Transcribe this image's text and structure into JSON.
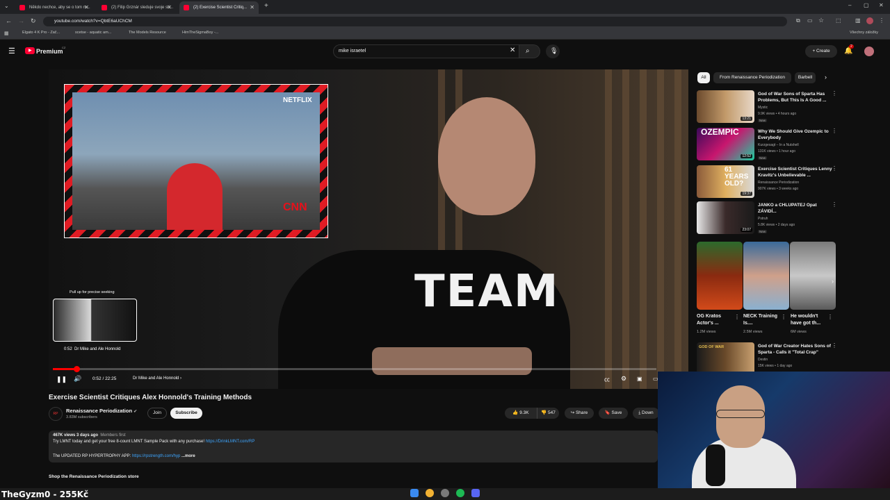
{
  "browser": {
    "tabs": [
      {
        "label": "Někdo nechce, aby se o tom m..."
      },
      {
        "label": "(2) Filip Grznár sleduje svoje sti..."
      },
      {
        "label": "(2) Exercise Scientist Critiq..."
      }
    ],
    "url": "youtube.com/watch?v=QbtE6aUChCM",
    "bookmarks": [
      "Elgato 4 K Pro - Zač...",
      "scetse - aquatic am...",
      "The Models Resource",
      "HimTheSigmaBoy -..."
    ],
    "all_bookmarks": "Všechny záložky"
  },
  "yt": {
    "logo": "Premium",
    "logo_region": "CZ",
    "search_value": "mike israetel",
    "create_label": "Create",
    "notif_count": "2"
  },
  "player": {
    "pip_netflix": "NETFLIX",
    "pip_cnn": "CNN",
    "shirt_text": "TEAM",
    "preview_hint": "Pull up for precise seeking",
    "preview_time": "0:52",
    "preview_chapter": "Dr Mike and Ale Honnold",
    "time": "0:52 / 22:25",
    "chapter": "Dr Mike and Ale Honnold",
    "progress_fraction": 0.039
  },
  "video": {
    "title": "Exercise Scientist Critiques Alex Honnold's Training Methods",
    "channel": "Renaissance Periodization",
    "channel_avatar_text": "RP",
    "subs": "3.83M subscribers",
    "join": "Join",
    "subscribe": "Subscribe",
    "likes": "9.3K",
    "dislikes": "547",
    "share": "Share",
    "save": "Save",
    "download": "Down",
    "desc_meta": "467K views  3 days ago",
    "desc_members": "Members first",
    "desc_line1": "Try LMNT today and get your free 8-count LMNT Sample Pack with any purchase!",
    "desc_link1": "https://DrinkLMNT.com/RP",
    "desc_line2": "The UPDATED RP HYPERTROPHY APP:",
    "desc_link2": "https://rpstrength.com/hyp",
    "desc_more": "...more",
    "shop": "Shop the Renaissance Periodization store"
  },
  "sidebar": {
    "chips": [
      "All",
      "From Renaissance Periodization",
      "Barbell"
    ],
    "recs": [
      {
        "title": "God of War Sons of Sparta Has Problems, But This Is A Good ...",
        "channel": "Mystic",
        "meta": "9.9K views • 4 hours ago",
        "new": "New",
        "dur": "13:21"
      },
      {
        "title": "Why We Should Give Ozempic to Everybody",
        "channel": "Kurzgesagt – In a Nutshell",
        "meta": "131K views • 1 hour ago",
        "new": "New",
        "dur": "12:52",
        "thumb_text": "OZEMPIC"
      },
      {
        "title": "Exercise Scientist Critiques Lenny Kravitz's Unbelievable ...",
        "channel": "Renaissance Periodization",
        "meta": "907K views • 3 weeks ago",
        "new": "",
        "dur": "19:37",
        "thumb_text": "61 YEARS OLD?"
      },
      {
        "title": "JANKO a CHLUPATEJ Opat ZÁVIDÍ...",
        "channel": "Pstruh",
        "meta": "5.8K views • 2 days ago",
        "new": "New",
        "dur": "23:07"
      }
    ],
    "shorts": [
      {
        "title": "OG Kratos Actor's ...",
        "views": "1.2M views"
      },
      {
        "title": "NECK Training Is....",
        "views": "2.5M views"
      },
      {
        "title": "He wouldn't have got th...",
        "views": "6M views"
      }
    ],
    "last": {
      "title": "God of War Creator Hates Sons of Sparta - Calls it \"Total Crap\"",
      "channel": "Destin",
      "meta": "15K views • 1 day ago",
      "thumb_text": "GOD OF WAR"
    }
  },
  "stream_overlay": "TheGyzm0 - 255Kč"
}
